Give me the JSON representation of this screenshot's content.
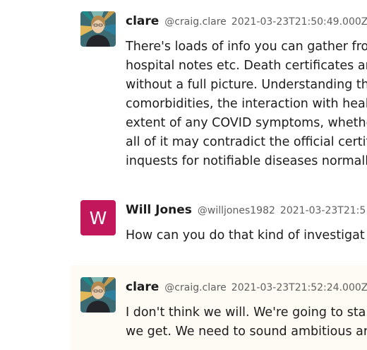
{
  "messages": [
    {
      "name": "clare",
      "handle": "@craig.clare",
      "timestamp": "2021-03-23T21:50:49.000Z",
      "avatar_icon": "portrait-photo",
      "lines": [
        "There's loads of info you can gather fro",
        "hospital notes etc. Death certificates ar",
        "without a full picture. Understanding th",
        "comorbidities, the interaction with heal",
        "extent of any COVID symptoms, whethe",
        "all of it may contradict the official certif",
        "inquests for notifiable diseases normall"
      ]
    },
    {
      "name": "Will Jones",
      "handle": "@willjones1982",
      "timestamp": "2021-03-23T21:5",
      "avatar_letter": "W",
      "avatar_color": "#c2185b",
      "lines": [
        "How can you do that kind of investigat"
      ]
    },
    {
      "name": "clare",
      "handle": "@craig.clare",
      "timestamp": "2021-03-23T21:52:24.000Z",
      "avatar_icon": "portrait-photo",
      "lines": [
        "I don't think we will. We're going to sta",
        "we get. We need to sound ambitious ar"
      ]
    }
  ]
}
